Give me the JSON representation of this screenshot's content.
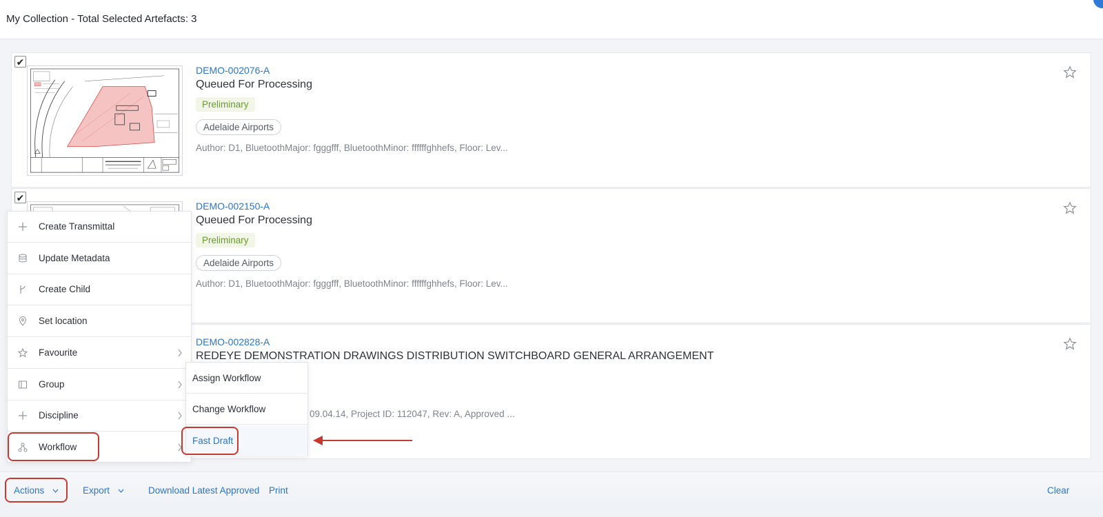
{
  "header": {
    "title": "My Collection - Total Selected Artefacts: 3"
  },
  "cards": [
    {
      "id": "DEMO-002076-A",
      "status": "Queued For Processing",
      "stage": "Preliminary",
      "org": "Adelaide Airports",
      "meta": "Author: D1, BluetoothMajor: fgggfff, BluetoothMinor: ffffffghhefs, Floor: Lev...",
      "checked": "✔"
    },
    {
      "id": "DEMO-002150-A",
      "status": "Queued For Processing",
      "stage": "Preliminary",
      "org": "Adelaide Airports",
      "meta": "Author: D1, BluetoothMajor: fgggfff, BluetoothMinor: ffffffghhefs, Floor: Lev...",
      "checked": "✔"
    },
    {
      "id": "DEMO-002828-A",
      "status": "REDEYE DEMONSTRATION DRAWINGS DISTRIBUTION SWITCHBOARD GENERAL ARRANGEMENT",
      "meta_partial": "e: 09.04.14, Project ID: 112047, Rev: A, Approved ..."
    }
  ],
  "actions_menu": {
    "items": [
      {
        "label": "Create Transmittal",
        "icon": "plus-icon"
      },
      {
        "label": "Update Metadata",
        "icon": "database-icon"
      },
      {
        "label": "Create Child",
        "icon": "branch-icon"
      },
      {
        "label": "Set location",
        "icon": "location-pin-icon"
      },
      {
        "label": "Favourite",
        "icon": "star-icon"
      },
      {
        "label": "Group",
        "icon": "group-icon"
      },
      {
        "label": "Discipline",
        "icon": "plus-icon"
      },
      {
        "label": "Workflow",
        "icon": "workflow-icon"
      }
    ]
  },
  "workflow_submenu": {
    "items": [
      {
        "label": "Assign Workflow"
      },
      {
        "label": "Change Workflow"
      },
      {
        "label": "Fast Draft"
      }
    ]
  },
  "toolbar": {
    "actions": "Actions",
    "export": "Export",
    "download": "Download Latest Approved",
    "print": "Print",
    "clear": "Clear"
  },
  "colors": {
    "link": "#2a75c8",
    "highlight": "#c7392f",
    "preliminary": "#6a9a2f"
  }
}
